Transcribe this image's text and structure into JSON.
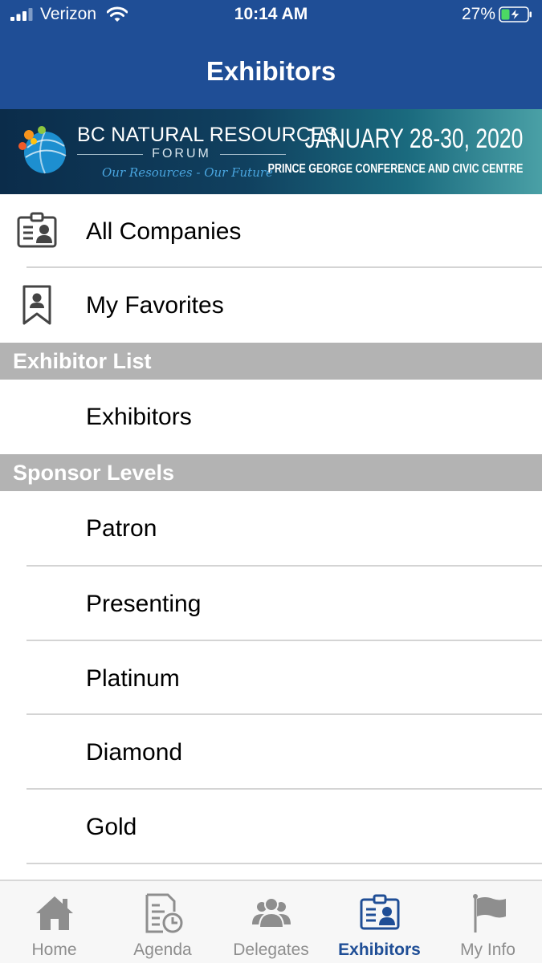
{
  "status_bar": {
    "carrier": "Verizon",
    "time": "10:14 AM",
    "battery": "27%"
  },
  "header": {
    "title": "Exhibitors"
  },
  "banner": {
    "name": "BC NATURAL RESOURCES",
    "forum": "FORUM",
    "tagline": "Our Resources - Our Future",
    "dates": "JANUARY 28-30, 2020",
    "venue": "PRINCE GEORGE CONFERENCE AND CIVIC CENTRE"
  },
  "menu": {
    "all_companies": "All Companies",
    "my_favorites": "My Favorites"
  },
  "sections": {
    "exhibitor_list": {
      "title": "Exhibitor List",
      "items": [
        "Exhibitors"
      ]
    },
    "sponsor_levels": {
      "title": "Sponsor Levels",
      "items": [
        "Patron",
        "Presenting",
        "Platinum",
        "Diamond",
        "Gold"
      ]
    }
  },
  "tabs": [
    {
      "label": "Home",
      "icon": "home-icon"
    },
    {
      "label": "Agenda",
      "icon": "agenda-icon"
    },
    {
      "label": "Delegates",
      "icon": "delegates-icon"
    },
    {
      "label": "Exhibitors",
      "icon": "exhibitors-icon",
      "active": true
    },
    {
      "label": "My Info",
      "icon": "flag-icon"
    }
  ],
  "colors": {
    "primary": "#1f4e96",
    "section_header": "#b3b3b3",
    "tab_inactive": "#8e8e8e",
    "battery_charge": "#4cd964"
  }
}
